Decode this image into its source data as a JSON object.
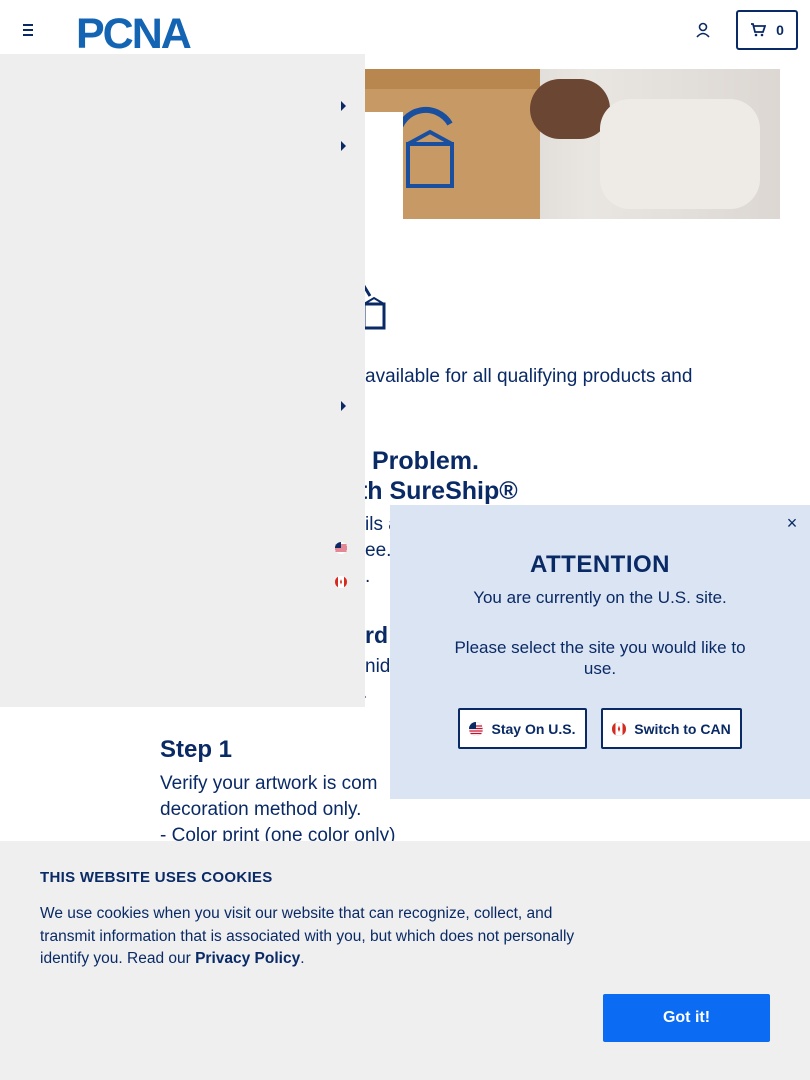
{
  "header": {
    "logo_text": "PCNA",
    "cart_count": "0"
  },
  "page": {
    "available_text": "available for all qualifying products and",
    "heading_line1": "Problem.",
    "heading_line2": "ith SureShip®",
    "body_line1": "ils a",
    "body_line2": "ee.",
    "body_line3": ".",
    "heading_partial": "rd",
    "body_line4": "nidr",
    "body_line5": ".",
    "step_heading": "Step 1",
    "step_text_1": "Verify your artwork is com",
    "step_text_2": "decoration method only.",
    "step_text_3": "-  Color print (one color only)"
  },
  "modal": {
    "close_label": "×",
    "title": "ATTENTION",
    "subtitle": "You are currently on the U.S. site.",
    "prompt": "Please select the site you would like to use.",
    "stay_label": "Stay On U.S.",
    "switch_label": "Switch to CAN"
  },
  "cookie": {
    "title": "THIS WEBSITE USES COOKIES",
    "text": "We use cookies when you visit our website that can recognize, collect, and transmit information that is associated with you, but which does not personally identify you. Read our ",
    "link_label": "Privacy Policy",
    "text_end": ".",
    "button_label": "Got it!"
  },
  "icons": [
    "menu-icon",
    "account-icon",
    "cart-icon",
    "us-flag-icon",
    "canada-flag-icon",
    "close-icon",
    "sureship-icon"
  ],
  "colors": {
    "navy": "#0a2a66",
    "blue": "#0b6cf3",
    "modal_bg": "#dbe4f2",
    "banner_bg": "#efefef",
    "drawer_bg": "#eeeeee"
  }
}
